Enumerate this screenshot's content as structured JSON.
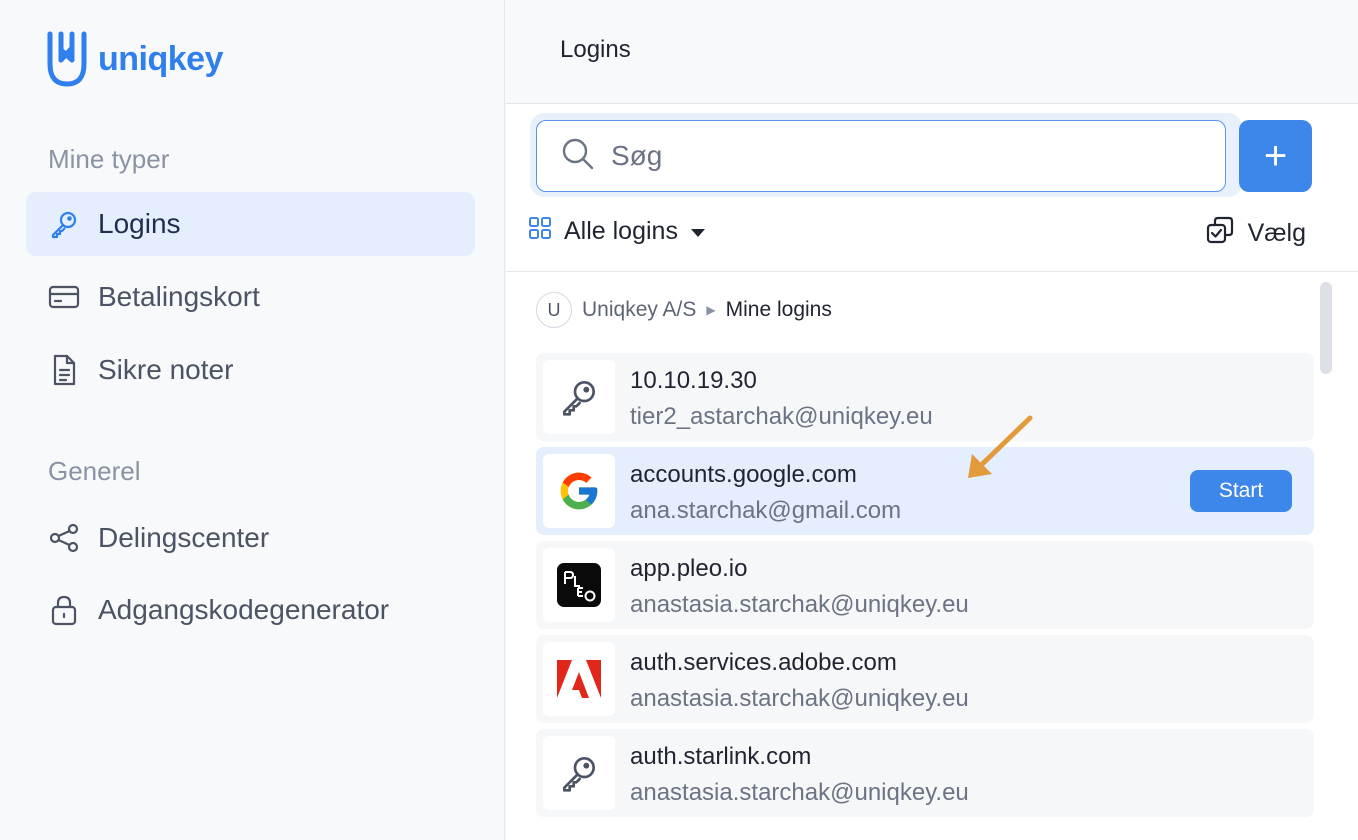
{
  "brand": {
    "name": "uniqkey",
    "color": "#2f80ed"
  },
  "sidebar": {
    "section_my_types": "Mine typer",
    "section_general": "Generel",
    "items": [
      {
        "label": "Logins",
        "icon": "key-icon",
        "active": true
      },
      {
        "label": "Betalingskort",
        "icon": "credit-card-icon"
      },
      {
        "label": "Sikre noter",
        "icon": "document-icon"
      },
      {
        "label": "Delingscenter",
        "icon": "share-icon"
      },
      {
        "label": "Adgangskodegenerator",
        "icon": "lock-icon"
      }
    ]
  },
  "header": {
    "title": "Logins"
  },
  "search": {
    "placeholder": "Søg",
    "value": ""
  },
  "toolbar": {
    "add_label": "+",
    "filter_label": "Alle logins",
    "select_label": "Vælg"
  },
  "breadcrumb": {
    "avatar_letter": "U",
    "org": "Uniqkey A/S",
    "current": "Mine logins"
  },
  "logins": [
    {
      "title": "10.10.19.30",
      "subtitle": "tier2_astarchak@uniqkey.eu",
      "icon": "key-icon"
    },
    {
      "title": "accounts.google.com",
      "subtitle": "ana.starchak@gmail.com",
      "icon": "google-icon",
      "action": "Start"
    },
    {
      "title": "app.pleo.io",
      "subtitle": "anastasia.starchak@uniqkey.eu",
      "icon": "pleo-icon"
    },
    {
      "title": "auth.services.adobe.com",
      "subtitle": "anastasia.starchak@uniqkey.eu",
      "icon": "adobe-icon"
    },
    {
      "title": "auth.starlink.com",
      "subtitle": "anastasia.starchak@uniqkey.eu",
      "icon": "key-icon"
    }
  ],
  "colors": {
    "accent": "#3d86ea",
    "active_bg": "#e4eefc",
    "annotation_arrow": "#e39a3b"
  }
}
